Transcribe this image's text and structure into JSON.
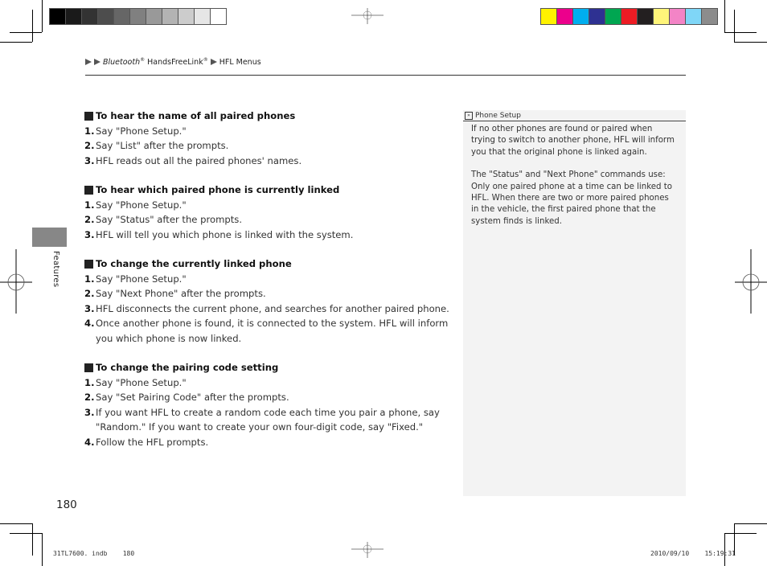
{
  "colors": {
    "grayscale_bar": [
      "#000000",
      "#1a1a1a",
      "#333333",
      "#4d4d4d",
      "#666666",
      "#808080",
      "#999999",
      "#b3b3b3",
      "#cccccc",
      "#e6e6e6",
      "#ffffff"
    ],
    "process_bar": [
      "#fff200",
      "#ec008c",
      "#00aeef",
      "#2e3192",
      "#00a651",
      "#ed1c24",
      "#231f20",
      "#fff57a",
      "#f384c6",
      "#7fd6f7",
      "#8c8c8c"
    ],
    "side_tab": "#878787",
    "note_bg": "#f3f3f3"
  },
  "breadcrumb": {
    "item1": "Bluetooth",
    "item1_mark": "®",
    "item2": "HandsFreeLink",
    "item2_mark": "®",
    "item3": "HFL Menus"
  },
  "side_label": "Features",
  "sections": [
    {
      "title": "To hear the name of all paired phones",
      "steps": [
        {
          "num": "1.",
          "text": "Say \"Phone Setup.\""
        },
        {
          "num": "2.",
          "text": "Say \"List\" after the prompts."
        },
        {
          "num": "3.",
          "text": "HFL reads out all the paired phones' names."
        }
      ]
    },
    {
      "title": "To hear which paired phone is currently linked",
      "steps": [
        {
          "num": "1.",
          "text": "Say \"Phone Setup.\""
        },
        {
          "num": "2.",
          "text": "Say \"Status\" after the prompts."
        },
        {
          "num": "3.",
          "text": "HFL will tell you which phone is linked with the system."
        }
      ]
    },
    {
      "title": "To change the currently linked phone",
      "steps": [
        {
          "num": "1.",
          "text": "Say \"Phone Setup.\""
        },
        {
          "num": "2.",
          "text": "Say \"Next Phone\" after the prompts."
        },
        {
          "num": "3.",
          "text": "HFL disconnects the current phone, and searches for another paired phone."
        },
        {
          "num": "4.",
          "text": "Once another phone is found, it is connected to the system. HFL will inform you which phone is now linked."
        }
      ]
    },
    {
      "title": "To change the pairing code setting",
      "steps": [
        {
          "num": "1.",
          "text": "Say \"Phone Setup.\""
        },
        {
          "num": "2.",
          "text": "Say \"Set Pairing Code\" after the prompts."
        },
        {
          "num": "3.",
          "text": "If you want HFL to create a random code each time you pair a phone, say \"Random.\" If you want to create your own four-digit code, say \"Fixed.\""
        },
        {
          "num": "4.",
          "text": "Follow the HFL prompts."
        }
      ]
    }
  ],
  "note": {
    "icon": "cross-reference-icon",
    "title": "Phone Setup",
    "paragraphs": [
      "If no other phones are found or paired when trying to switch to another phone, HFL will inform you that the original phone is linked again.",
      "The \"Status\" and \"Next Phone\" commands use: Only one paired phone at a time can be linked to HFL. When there are two or more paired phones in the vehicle, the first paired phone that the system finds is linked."
    ]
  },
  "page_number": "180",
  "footer": {
    "file": "31TL7600. indb",
    "page": "180",
    "date": "2010/09/10",
    "time": "15:19:31"
  }
}
